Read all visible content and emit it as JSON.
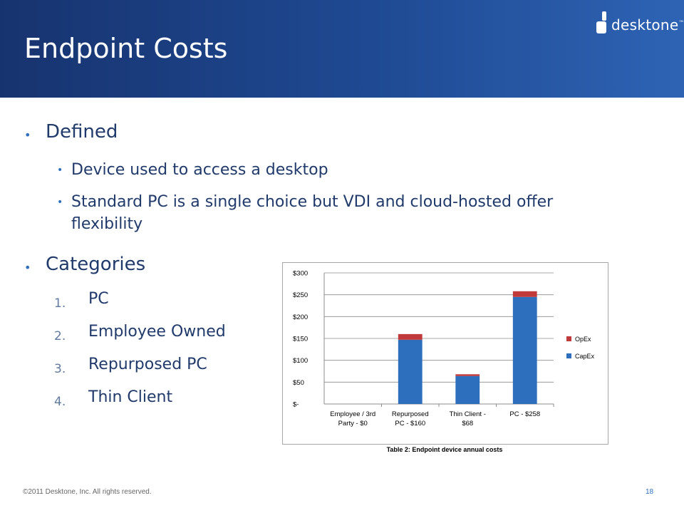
{
  "slide": {
    "title": "Endpoint Costs",
    "logo_text": "desktone",
    "logo_tm": "™",
    "footer": "©2011 Desktone, Inc. All rights reserved.",
    "page_number": "18",
    "colors": {
      "header": "#1f4a93",
      "accent": "#2e6fbd",
      "text": "#1f3a6b"
    }
  },
  "bullets": {
    "defined": {
      "label": "Defined",
      "items": [
        "Device used to access a desktop",
        "Standard PC is a single choice but VDI and cloud-hosted offer",
        "flexibility"
      ]
    },
    "categories": {
      "label": "Categories",
      "items": [
        {
          "num": "1.",
          "label": "PC"
        },
        {
          "num": "2.",
          "label": "Employee Owned"
        },
        {
          "num": "3.",
          "label": "Repurposed PC"
        },
        {
          "num": "4.",
          "label": "Thin Client"
        }
      ]
    }
  },
  "chart_data": {
    "type": "bar",
    "stacked": true,
    "categories": [
      [
        "Employee / 3rd",
        "Party - $0"
      ],
      [
        "Repurposed",
        "PC - $160"
      ],
      [
        "Thin Client -",
        "$68"
      ],
      [
        "PC - $258"
      ]
    ],
    "series": [
      {
        "name": "CapEx",
        "color": "#2e6fbd",
        "values": [
          0,
          147,
          64,
          245
        ]
      },
      {
        "name": "OpEx",
        "color": "#c0393b",
        "values": [
          0,
          13,
          4,
          13
        ]
      }
    ],
    "ylim": [
      0,
      300
    ],
    "yticks": [
      {
        "value": 0,
        "label": "$-"
      },
      {
        "value": 50,
        "label": "$50"
      },
      {
        "value": 100,
        "label": "$100"
      },
      {
        "value": 150,
        "label": "$150"
      },
      {
        "value": 200,
        "label": "$200"
      },
      {
        "value": 250,
        "label": "$250"
      },
      {
        "value": 300,
        "label": "$300"
      }
    ],
    "legend_position": "right",
    "legend": [
      "OpEx",
      "CapEx"
    ],
    "grid": true,
    "caption": "Table 2: Endpoint device annual costs"
  }
}
